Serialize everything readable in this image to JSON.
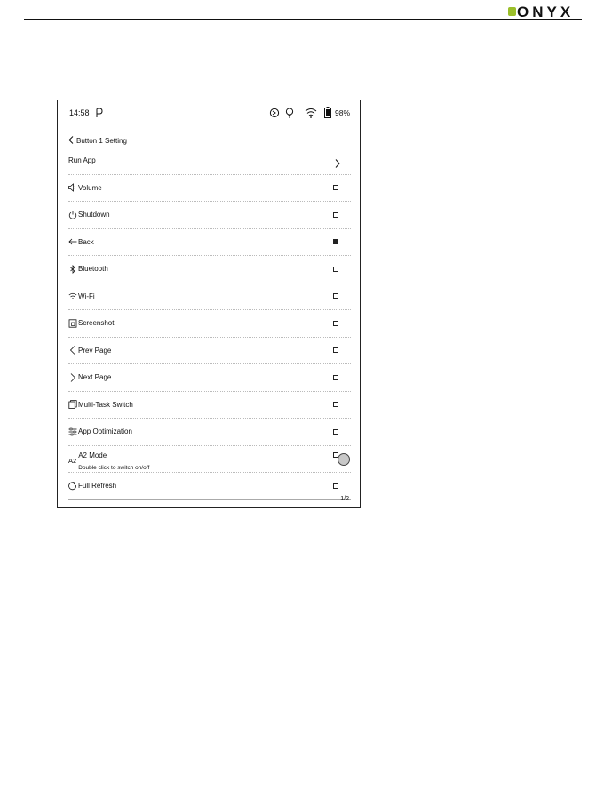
{
  "brand": {
    "logo_text": "ONYX",
    "accent_color": "#9bbf2a"
  },
  "status_bar": {
    "time": "14:58",
    "battery": "98%",
    "icons": [
      "pen-icon",
      "sync-icon",
      "bulb-icon",
      "wifi-icon",
      "battery-icon"
    ]
  },
  "header": {
    "title": "Button 1 Setting"
  },
  "run_app": {
    "label": "Run App"
  },
  "items": [
    {
      "label": "Volume",
      "icon": "speaker-icon",
      "checked": false
    },
    {
      "label": "Shutdown",
      "icon": "power-icon",
      "checked": false
    },
    {
      "label": "Back",
      "icon": "arrow-left-icon",
      "checked": true
    },
    {
      "label": "Bluetooth",
      "icon": "bluetooth-icon",
      "checked": false
    },
    {
      "label": "Wi-Fi",
      "icon": "wifi-icon",
      "checked": false
    },
    {
      "label": "Screenshot",
      "icon": "screenshot-icon",
      "checked": false
    },
    {
      "label": "Prev Page",
      "icon": "chevron-left-icon",
      "checked": false
    },
    {
      "label": "Next Page",
      "icon": "chevron-right-icon",
      "checked": false
    },
    {
      "label": "Multi-Task Switch",
      "icon": "multitask-icon",
      "checked": false
    },
    {
      "label": "App Optimization",
      "icon": "optimization-icon",
      "checked": false
    },
    {
      "label": "A2 Mode",
      "prefix": "A2",
      "sub": "Double click to switch on/off",
      "checked": false
    },
    {
      "label": "Full Refresh",
      "icon": "refresh-icon",
      "checked": false
    }
  ],
  "pager": "1/2"
}
